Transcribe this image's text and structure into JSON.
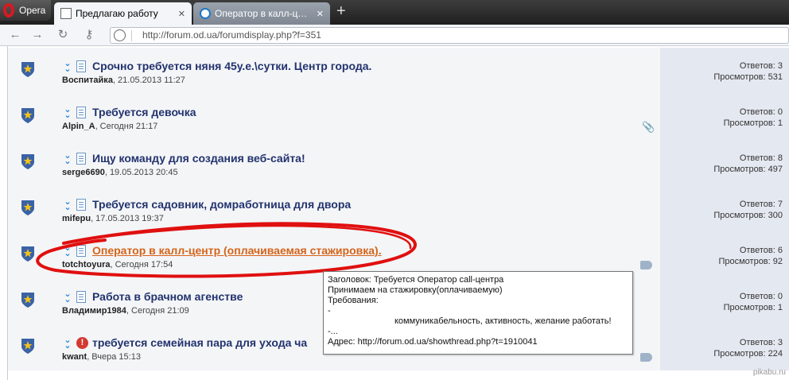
{
  "browser": {
    "menu_label": "Opera",
    "tabs": [
      {
        "title": "Предлагаю работу",
        "active": true,
        "close": "✕"
      },
      {
        "title": "Оператор в калл-центр",
        "active": false,
        "close": "✕"
      }
    ],
    "new_tab": "+",
    "url": "http://forum.od.ua/forumdisplay.php?f=351"
  },
  "threads": [
    {
      "title": "Срочно требуется няня 45у.е.\\сутки. Центр города.",
      "author": "Воспитайка",
      "date": ", 21.05.2013 11:27",
      "replies": "Ответов: 3",
      "views": "Просмотров: 531",
      "icon": "doc",
      "extra": ""
    },
    {
      "title": "Требуется девочка",
      "author": "Alpin_A",
      "date": ", Сегодня 21:17",
      "replies": "Ответов: 0",
      "views": "Просмотров: 1",
      "icon": "doc",
      "extra": "paperclip-icon"
    },
    {
      "title": "Ищу команду для создания веб-сайта!",
      "author": "serge6690",
      "date": ", 19.05.2013 20:45",
      "replies": "Ответов: 8",
      "views": "Просмотров: 497",
      "icon": "doc",
      "extra": ""
    },
    {
      "title": "Требуется садовник, домработница для двора",
      "author": "mifepu",
      "date": ", 17.05.2013 19:37",
      "replies": "Ответов: 7",
      "views": "Просмотров: 300",
      "icon": "doc",
      "extra": ""
    },
    {
      "title": "Оператор в калл-центр (оплачиваемая стажировка).",
      "author": "totchtoyura",
      "date": ", Сегодня 17:54",
      "replies": "Ответов: 6",
      "views": "Просмотров: 92",
      "icon": "doc",
      "extra": "tag-icon",
      "hovered": true
    },
    {
      "title": "Работа в брачном агенстве",
      "author": "Владимир1984",
      "date": ", Сегодня 21:09",
      "replies": "Ответов: 0",
      "views": "Просмотров: 1",
      "icon": "doc",
      "extra": ""
    },
    {
      "title": "требуется семейная пара для ухода ча",
      "author": "kwant",
      "date": ", Вчера 15:13",
      "replies": "Ответов: 3",
      "views": "Просмотров: 224",
      "icon": "alert",
      "extra": "tag-icon"
    }
  ],
  "tooltip": {
    "lines": [
      "Заголовок: Требуется Оператор call-центра",
      "Принимаем на стажировку(оплачиваемую)",
      "Требования:",
      "-",
      "коммуникабельность, активность, желание работать!",
      "-...",
      "Адрес: http://forum.od.ua/showthread.php?t=1910041"
    ]
  },
  "watermark": "pikabu.ru",
  "colors": {
    "title": "#22336e",
    "hover_title": "#d4641a",
    "highlight": "#e01010"
  }
}
